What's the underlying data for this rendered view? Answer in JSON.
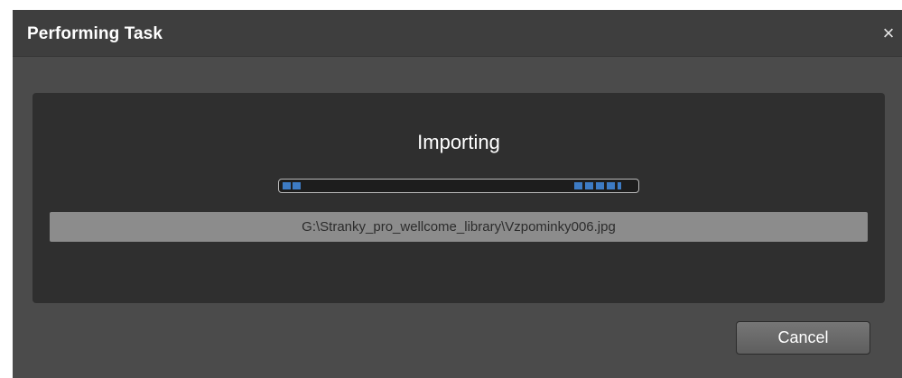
{
  "dialog": {
    "title": "Performing Task",
    "close_glyph": "×",
    "close_icon": "close-icon"
  },
  "task": {
    "status": "Importing",
    "file_path": "G:\\Stranky_pro_wellcome_library\\Vzpominky006.jpg",
    "progress_style": "indeterminate-marquee"
  },
  "buttons": {
    "cancel_label": "Cancel"
  },
  "colors": {
    "window_bg": "#4b4b4b",
    "titlebar_bg": "#3e3e3e",
    "panel_bg": "#2f2f2f",
    "progress_segment": "#3d7bc4",
    "path_bar_bg": "#8c8c8c"
  }
}
